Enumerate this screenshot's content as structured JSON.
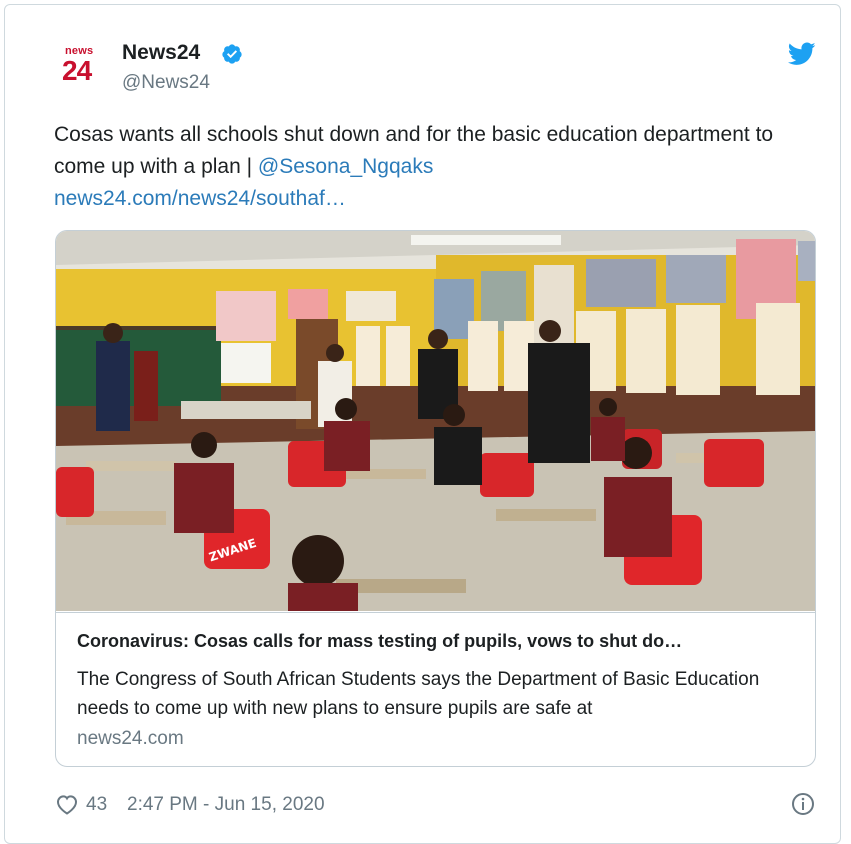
{
  "account": {
    "logo_small": "news",
    "logo_big": "24",
    "name": "News24",
    "handle": "@News24"
  },
  "tweet": {
    "text_main": "Cosas wants all schools shut down and for the basic education department to come up with a plan | ",
    "mention": "@Sesona_Ngqaks",
    "link": "news24.com/news24/southaf…"
  },
  "link_card": {
    "title": "Coronavirus: Cosas calls for mass testing of pupils, vows to shut do…",
    "description": "The Congress of South African Students says the Department of Basic Education needs to come up with new plans to ensure pupils are safe at",
    "domain": "news24.com",
    "photo_chair_text": "ZWANE"
  },
  "footer": {
    "likes": "43",
    "timestamp": "2:47 PM - Jun 15, 2020"
  },
  "colors": {
    "link": "#2b7bb9",
    "brand_red": "#c8102e",
    "verified": "#1da1f2",
    "muted": "#697882"
  }
}
